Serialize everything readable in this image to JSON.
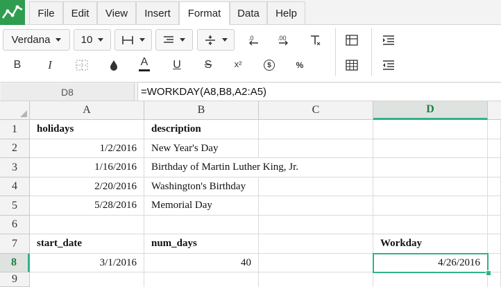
{
  "menubar": {
    "items": [
      {
        "id": "file",
        "label": "File"
      },
      {
        "id": "edit",
        "label": "Edit"
      },
      {
        "id": "view",
        "label": "View"
      },
      {
        "id": "insert",
        "label": "Insert"
      },
      {
        "id": "format",
        "label": "Format"
      },
      {
        "id": "data",
        "label": "Data"
      },
      {
        "id": "help",
        "label": "Help"
      }
    ],
    "active": "format"
  },
  "toolbar": {
    "font_family": "Verdana",
    "font_size": "10",
    "icons_row1": [
      "borders-icon",
      "align-icon",
      "vertical-align-icon",
      "decrease-decimal-icon",
      "increase-decimal-icon",
      "clear-format-icon"
    ],
    "icons_row2": [
      "bold-icon",
      "italic-icon",
      "cell-border-icon",
      "fill-color-icon",
      "text-color-icon",
      "underline-icon",
      "strikethrough-icon",
      "superscript-icon",
      "currency-icon",
      "percent-icon"
    ],
    "labels": {
      "bold": "B",
      "italic": "I",
      "text_color": "A",
      "underline": "U",
      "strike": "S",
      "superscript": "x²",
      "currency": "$",
      "percent": "%"
    }
  },
  "formula_bar": {
    "cell_ref": "D8",
    "formula": "=WORKDAY(A8,B8,A2:A5)"
  },
  "sheet": {
    "columns": [
      "A",
      "B",
      "C",
      "D"
    ],
    "rows": [
      "1",
      "2",
      "3",
      "4",
      "5",
      "6",
      "7",
      "8",
      "9"
    ],
    "selected_col": "D",
    "selected_row": "8",
    "cells": {
      "A1": "holidays",
      "B1": "description",
      "A2": "1/2/2016",
      "B2": "New Year's Day",
      "A3": "1/16/2016",
      "B3": "Birthday of Martin Luther King, Jr.",
      "A4": "2/20/2016",
      "B4": "Washington's Birthday",
      "A5": "5/28/2016",
      "B5": "Memorial Day",
      "A7": "start_date",
      "B7": "num_days",
      "D7": "Workday",
      "A8": "3/1/2016",
      "B8": "40",
      "D8": "4/26/2016"
    }
  },
  "colors": {
    "accent": "#2fb38a",
    "logo": "#2e9d4f",
    "header_selected_text": "#1e7d45"
  }
}
